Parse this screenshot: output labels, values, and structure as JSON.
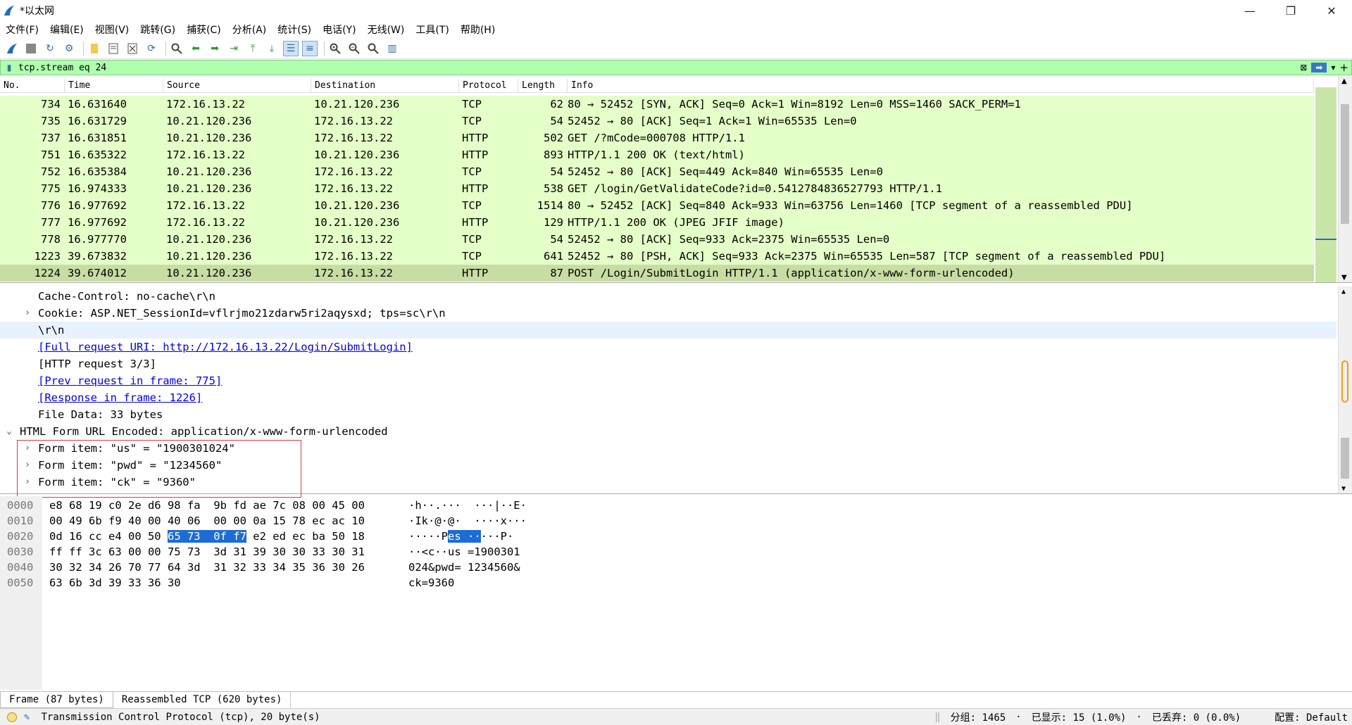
{
  "window": {
    "title": "*以太网",
    "min_icon": "minimize-icon",
    "max_icon": "restore-icon",
    "close_icon": "close-icon"
  },
  "menu": [
    "文件(F)",
    "编辑(E)",
    "视图(V)",
    "跳转(G)",
    "捕获(C)",
    "分析(A)",
    "统计(S)",
    "电话(Y)",
    "无线(W)",
    "工具(T)",
    "帮助(H)"
  ],
  "filter": {
    "value": "tcp.stream eq 24"
  },
  "columns": [
    "No.",
    "Time",
    "Source",
    "Destination",
    "Protocol",
    "Length",
    "Info"
  ],
  "packets": [
    {
      "no": "734",
      "time": "16.631640",
      "src": "172.16.13.22",
      "dst": "10.21.120.236",
      "proto": "TCP",
      "len": "62",
      "info": "80 → 52452 [SYN, ACK] Seq=0 Ack=1 Win=8192 Len=0 MSS=1460 SACK_PERM=1"
    },
    {
      "no": "735",
      "time": "16.631729",
      "src": "10.21.120.236",
      "dst": "172.16.13.22",
      "proto": "TCP",
      "len": "54",
      "info": "52452 → 80 [ACK] Seq=1 Ack=1 Win=65535 Len=0"
    },
    {
      "no": "737",
      "time": "16.631851",
      "src": "10.21.120.236",
      "dst": "172.16.13.22",
      "proto": "HTTP",
      "len": "502",
      "info": "GET /?mCode=000708 HTTP/1.1"
    },
    {
      "no": "751",
      "time": "16.635322",
      "src": "172.16.13.22",
      "dst": "10.21.120.236",
      "proto": "HTTP",
      "len": "893",
      "info": "HTTP/1.1 200 OK  (text/html)"
    },
    {
      "no": "752",
      "time": "16.635384",
      "src": "10.21.120.236",
      "dst": "172.16.13.22",
      "proto": "TCP",
      "len": "54",
      "info": "52452 → 80 [ACK] Seq=449 Ack=840 Win=65535 Len=0"
    },
    {
      "no": "775",
      "time": "16.974333",
      "src": "10.21.120.236",
      "dst": "172.16.13.22",
      "proto": "HTTP",
      "len": "538",
      "info": "GET /login/GetValidateCode?id=0.5412784836527793 HTTP/1.1"
    },
    {
      "no": "776",
      "time": "16.977692",
      "src": "172.16.13.22",
      "dst": "10.21.120.236",
      "proto": "TCP",
      "len": "1514",
      "info": "80 → 52452 [ACK] Seq=840 Ack=933 Win=63756 Len=1460 [TCP segment of a reassembled PDU]"
    },
    {
      "no": "777",
      "time": "16.977692",
      "src": "172.16.13.22",
      "dst": "10.21.120.236",
      "proto": "HTTP",
      "len": "129",
      "info": "HTTP/1.1 200 OK  (JPEG JFIF image)"
    },
    {
      "no": "778",
      "time": "16.977770",
      "src": "10.21.120.236",
      "dst": "172.16.13.22",
      "proto": "TCP",
      "len": "54",
      "info": "52452 → 80 [ACK] Seq=933 Ack=2375 Win=65535 Len=0"
    },
    {
      "no": "1223",
      "time": "39.673832",
      "src": "10.21.120.236",
      "dst": "172.16.13.22",
      "proto": "TCP",
      "len": "641",
      "info": "52452 → 80 [PSH, ACK] Seq=933 Ack=2375 Win=65535 Len=587 [TCP segment of a reassembled PDU]"
    },
    {
      "no": "1224",
      "time": "39.674012",
      "src": "10.21.120.236",
      "dst": "172.16.13.22",
      "proto": "HTTP",
      "len": "87",
      "info": "POST /Login/SubmitLogin HTTP/1.1  (application/x-www-form-urlencoded)"
    }
  ],
  "details": [
    {
      "text": "Cache-Control: no-cache\\r\\n",
      "arrow": "",
      "link": false
    },
    {
      "text": "Cookie: ASP.NET_SessionId=vflrjmo21zdarw5ri2aqysxd; tps=sc\\r\\n",
      "arrow": "›",
      "link": false
    },
    {
      "text": "\\r\\n",
      "arrow": "",
      "link": false
    },
    {
      "text": "[Full request URI: http://172.16.13.22/Login/SubmitLogin]",
      "arrow": "",
      "link": true
    },
    {
      "text": "[HTTP request 3/3]",
      "arrow": "",
      "link": false
    },
    {
      "text": "[Prev request in frame: 775]",
      "arrow": "",
      "link": true
    },
    {
      "text": "[Response in frame: 1226]",
      "arrow": "",
      "link": true
    },
    {
      "text": "File Data: 33 bytes",
      "arrow": "",
      "link": false
    },
    {
      "text": "HTML Form URL Encoded: application/x-www-form-urlencoded",
      "arrow": "⌄",
      "link": false
    },
    {
      "text": "Form item: \"us\" = \"1900301024\"",
      "arrow": "›",
      "link": false
    },
    {
      "text": "Form item: \"pwd\" = \"1234560\"",
      "arrow": "›",
      "link": false
    },
    {
      "text": "Form item: \"ck\" = \"9360\"",
      "arrow": "›",
      "link": false
    }
  ],
  "bytes": [
    {
      "off": "0000",
      "hexA": "e8 68 19 c0 2e d6 98 fa",
      "hexB": "9b fd ae 7c 08 00 45 00",
      "asc": "·h··.···  ···|··E·"
    },
    {
      "off": "0010",
      "hexA": "00 49 6b f9 40 00 40 06",
      "hexB": "00 00 0a 15 78 ec ac 10",
      "asc": "·Ik·@·@·  ····x···"
    },
    {
      "off": "0020",
      "hexA": "0d 16 cc e4 00 50 ",
      "hexSel": "65 73  0f f7",
      "hexC": " e2 ed ec ba 50 18",
      "ascA": "·····P",
      "ascSel": "es ··",
      "ascC": "···P·"
    },
    {
      "off": "0030",
      "hexA": "ff ff 3c 63 00 00 75 73",
      "hexB": "3d 31 39 30 30 33 30 31",
      "asc": "··<c··us =1900301"
    },
    {
      "off": "0040",
      "hexA": "30 32 34 26 70 77 64 3d",
      "hexB": "31 32 33 34 35 36 30 26",
      "asc": "024&pwd= 1234560&"
    },
    {
      "off": "0050",
      "hexA": "63 6b 3d 39 33 36 30",
      "hexB": "",
      "asc": "ck=9360"
    }
  ],
  "tabs": [
    "Frame (87 bytes)",
    "Reassembled TCP (620 bytes)"
  ],
  "status": {
    "field": "Transmission Control Protocol (tcp), 20 byte(s)",
    "packets": "分组: 1465",
    "displayed": "已显示: 15 (1.0%)",
    "dropped": "已丢弃: 0 (0.0%)",
    "profile": "配置: Default"
  },
  "colors": {
    "row_bg": "#e4ffc7",
    "row_selected": "#c8dda4",
    "filter_bg": "#afffaf",
    "hex_selection": "#1c6cd6",
    "annotation_box": "#e53935"
  }
}
